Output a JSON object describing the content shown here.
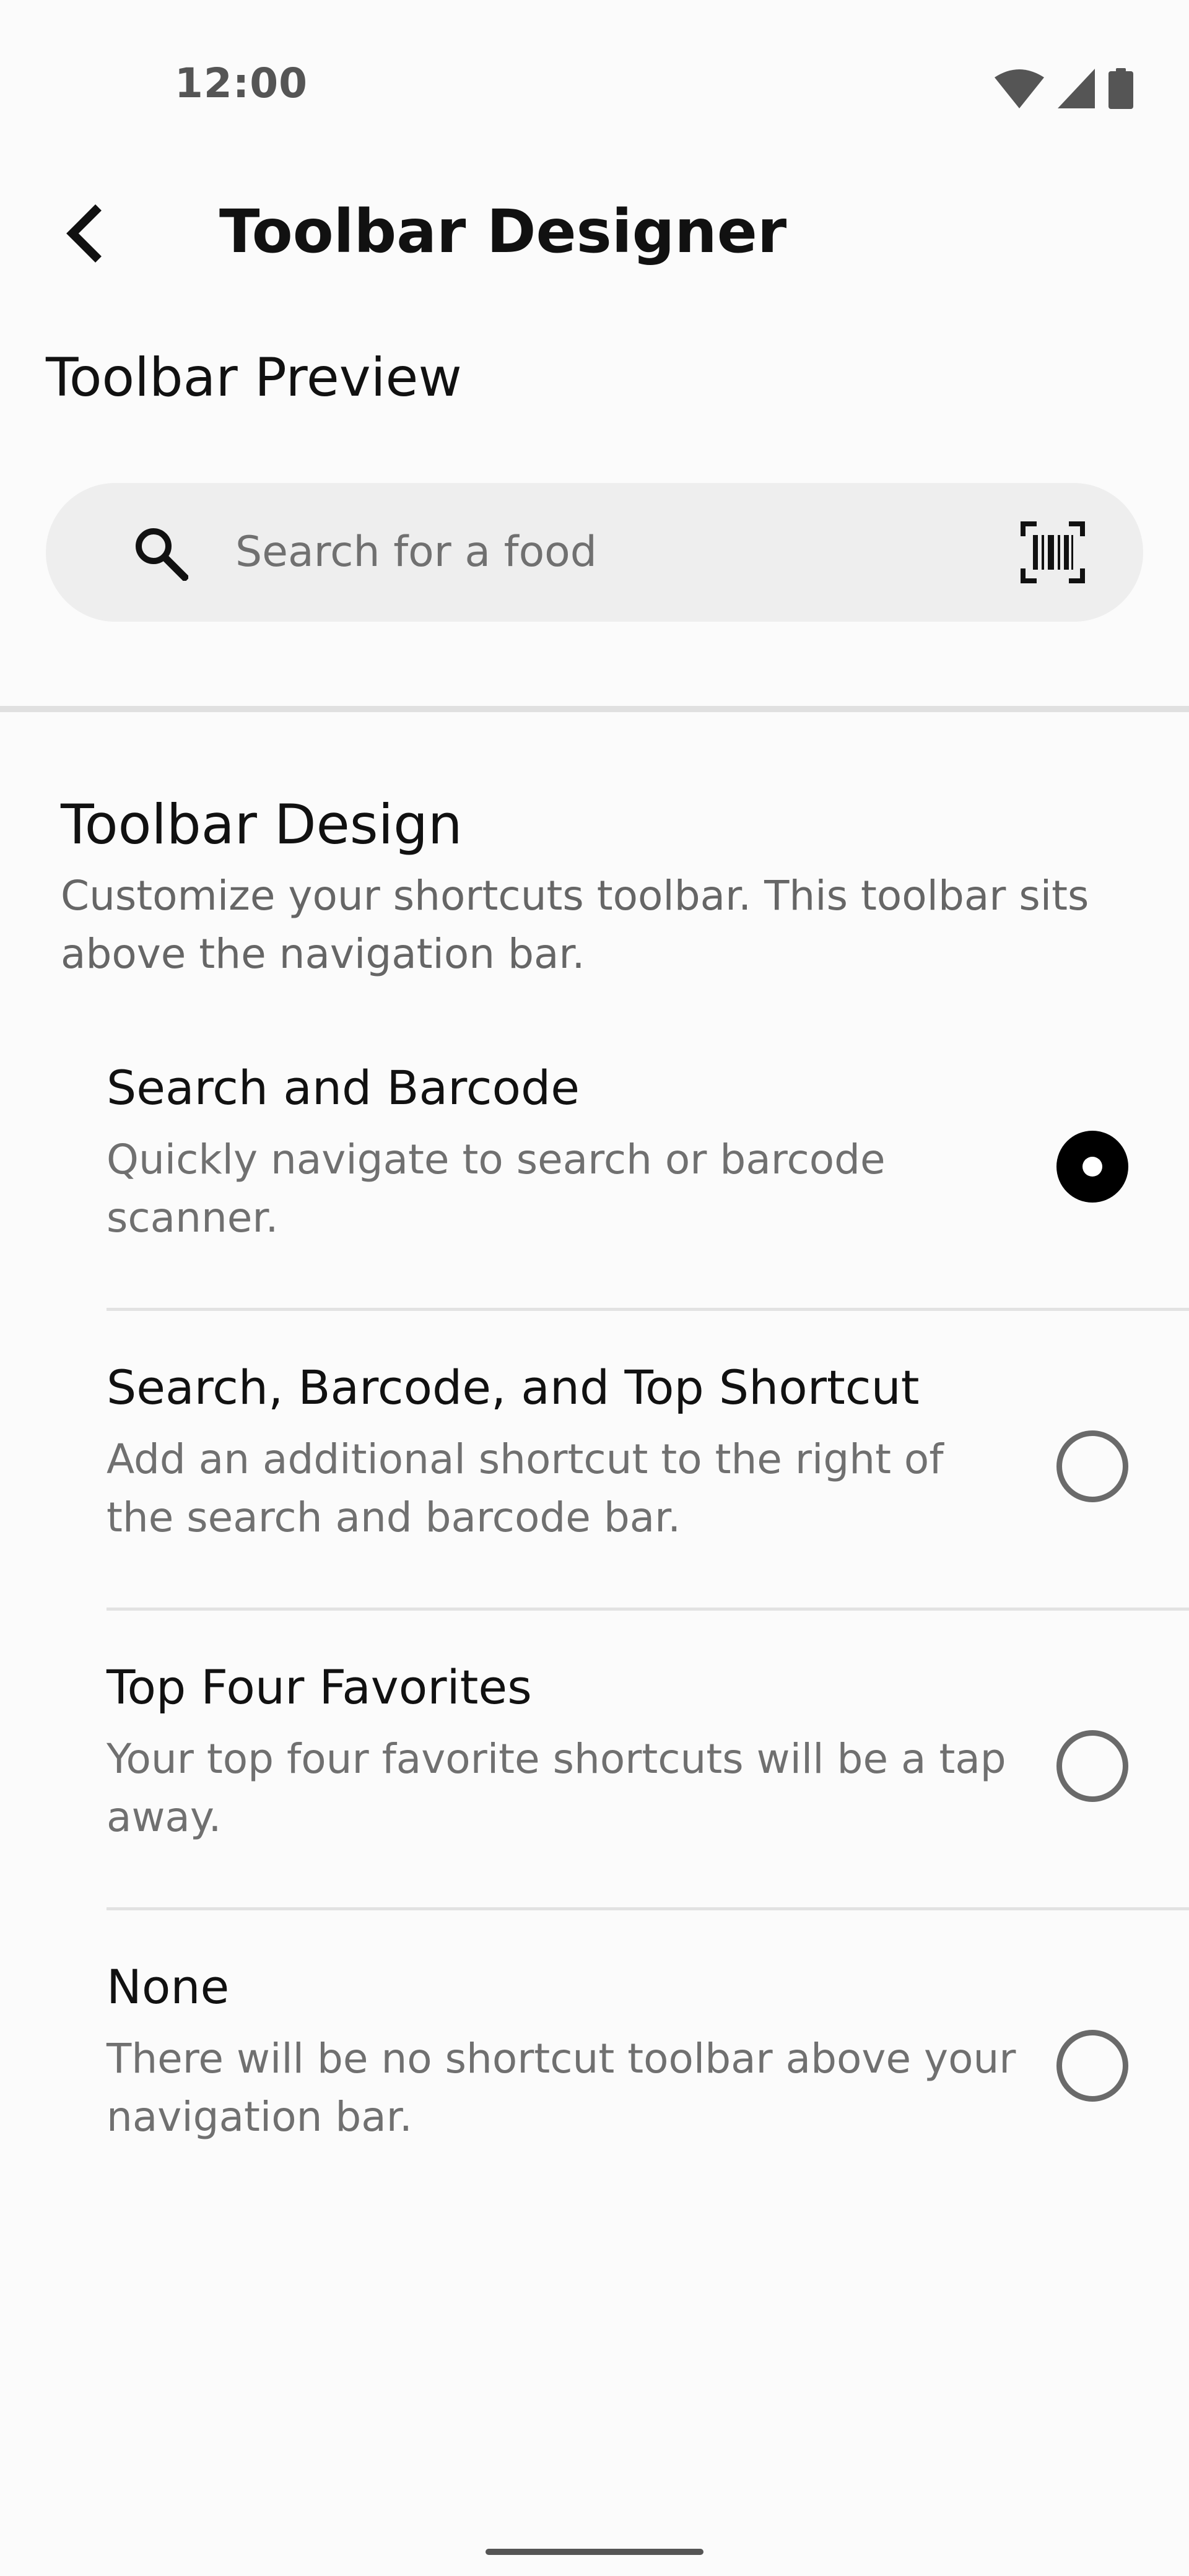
{
  "status_bar": {
    "time": "12:00",
    "icons": [
      "wifi-icon",
      "cell-signal-icon",
      "battery-icon"
    ]
  },
  "app_bar": {
    "back_icon": "chevron-left-icon",
    "title": "Toolbar Designer"
  },
  "preview": {
    "heading": "Toolbar Preview",
    "search": {
      "icon": "search-icon",
      "placeholder": "Search for a food",
      "barcode_icon": "barcode-scanner-icon"
    }
  },
  "design": {
    "heading": "Toolbar Design",
    "description": "Customize your shortcuts toolbar. This toolbar sits above the navigation bar.",
    "options": [
      {
        "title": "Search and Barcode",
        "description": "Quickly navigate to search or barcode scanner.",
        "selected": true
      },
      {
        "title": "Search, Barcode, and Top Shortcut",
        "description": "Add an additional shortcut to the right of the search and barcode bar.",
        "selected": false
      },
      {
        "title": "Top Four Favorites",
        "description": "Your top four favorite shortcuts will be a tap away.",
        "selected": false
      },
      {
        "title": "None",
        "description": "There will be no shortcut toolbar above your navigation bar.",
        "selected": false
      }
    ]
  },
  "colors": {
    "background": "#fbfbfb",
    "search_bg": "#eeeeee",
    "radio_selected": "#000000",
    "radio_unselected": "#6a6a6a",
    "secondary_text": "#707070"
  }
}
